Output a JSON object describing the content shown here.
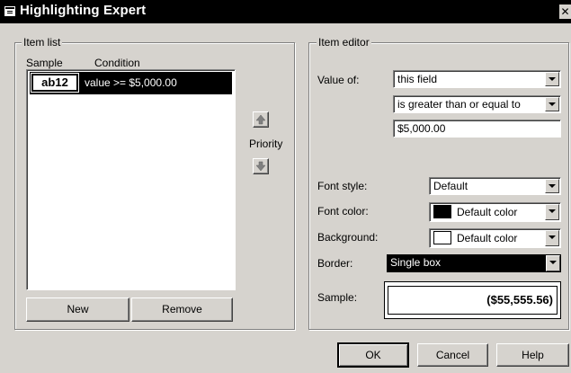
{
  "window": {
    "title": "Highlighting Expert",
    "close_glyph": "✕"
  },
  "item_list": {
    "group_label": "Item list",
    "col_sample": "Sample",
    "col_condition": "Condition",
    "rows": [
      {
        "sample": "ab12",
        "condition": "value >= $5,000.00",
        "selected": true
      }
    ],
    "new_label": "New",
    "remove_label": "Remove"
  },
  "priority": {
    "label": "Priority",
    "up_icon": "arrow-up-icon",
    "down_icon": "arrow-down-icon"
  },
  "item_editor": {
    "group_label": "Item editor",
    "value_of_label": "Value of:",
    "value_of": "this field",
    "operator": "is greater than or equal to",
    "value": "$5,000.00",
    "font_style_label": "Font style:",
    "font_style": "Default",
    "font_color_label": "Font color:",
    "font_color": "Default color",
    "font_color_swatch": "#000000",
    "background_label": "Background:",
    "background": "Default color",
    "background_swatch": "#ffffff",
    "border_label": "Border:",
    "border": "Single box",
    "sample_label": "Sample:",
    "sample_value": "($55,555.56)"
  },
  "footer": {
    "ok_label": "OK",
    "cancel_label": "Cancel",
    "help_label": "Help"
  },
  "colors": {
    "selection": "#000000",
    "face": "#d6d3ce"
  }
}
